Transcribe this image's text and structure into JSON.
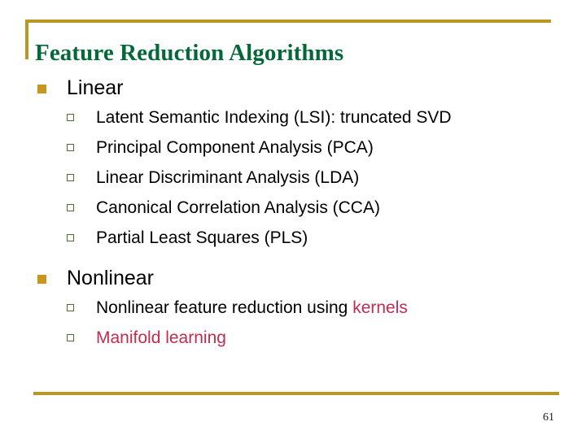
{
  "slide": {
    "title": "Feature Reduction Algorithms",
    "page_number": "61",
    "colors": {
      "title_green": "#056839",
      "rule_gold": "#b79825",
      "bullet_gold": "#c8961c",
      "bullet_green_outline": "#4c7030",
      "accent_red": "#c22c4e",
      "body_black": "#000000",
      "background": "#ffffff"
    },
    "sections": [
      {
        "heading": "Linear",
        "bullet_icon": "filled-square-bullet",
        "items": [
          {
            "text": "Latent Semantic Indexing (LSI): truncated SVD",
            "color": "black"
          },
          {
            "text": "Principal Component Analysis (PCA)",
            "color": "black"
          },
          {
            "text": "Linear Discriminant Analysis (LDA)",
            "color": "black"
          },
          {
            "text": "Canonical Correlation Analysis (CCA)",
            "color": "black"
          },
          {
            "text": "Partial Least Squares (PLS)",
            "color": "black"
          }
        ]
      },
      {
        "heading": "Nonlinear",
        "bullet_icon": "filled-square-bullet",
        "items": [
          {
            "text_lead": "Nonlinear feature reduction using ",
            "text_accent": "kernels",
            "color": "mixed"
          },
          {
            "text": "Manifold learning",
            "color": "red"
          }
        ]
      }
    ]
  }
}
